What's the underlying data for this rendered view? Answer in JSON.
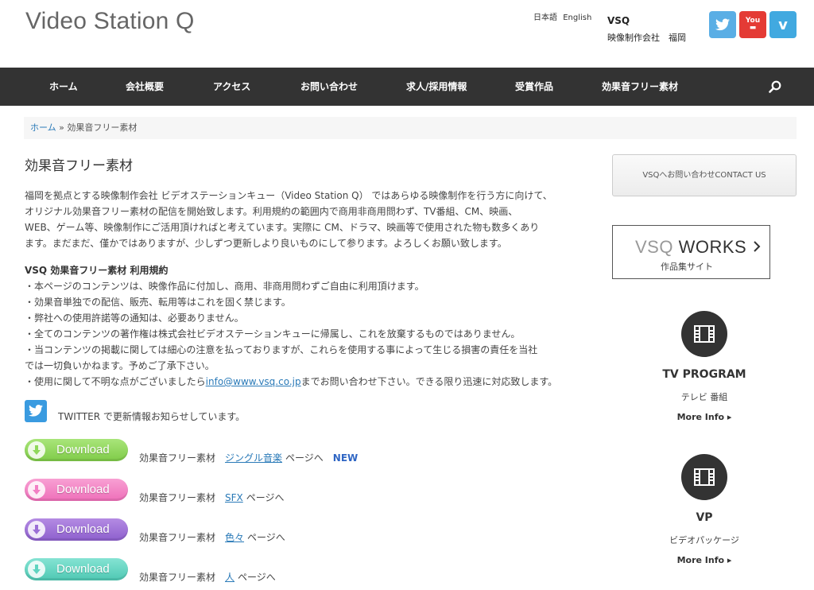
{
  "header": {
    "site_title": "Video Station Q",
    "lang_ja": "日本語",
    "lang_en": "English",
    "company_name": "VSQ",
    "company_desc": "映像制作会社　福岡",
    "social": [
      {
        "name": "twitter",
        "icon": "twitter-icon",
        "color": "#5aaee5"
      },
      {
        "name": "youtube",
        "icon": "youtube-icon",
        "color": "#e43b35",
        "label": "You"
      },
      {
        "name": "vimeo",
        "icon": "vimeo-icon",
        "color": "#41a9e0",
        "label": "v"
      }
    ]
  },
  "nav": {
    "items": [
      {
        "label": "ホーム"
      },
      {
        "label": "会社概要"
      },
      {
        "label": "アクセス"
      },
      {
        "label": "お問い合わせ"
      },
      {
        "label": "求人/採用情報"
      },
      {
        "label": "受賞作品"
      },
      {
        "label": "効果音フリー素材"
      }
    ],
    "search_icon": "search-icon"
  },
  "breadcrumb": {
    "home": "ホーム",
    "sep": " » ",
    "current": "効果音フリー素材"
  },
  "main": {
    "title": "効果音フリー素材",
    "intro_lines": [
      "福岡を拠点とする映像制作会社 ビデオステーションキュー（Video Station Q） ではあらゆる映像制作を行う方に向けて、",
      "オリジナル効果音フリー素材の配信を開始致します。利用規約の範囲内で商用非商用問わず、TV番組、CM、映画、",
      "WEB、ゲーム等、映像制作にご活用頂ければと考えています。実際に CM、ドラマ、映画等で使用された物も数多くあり",
      "ます。まだまだ、僅かではありますが、少しずつ更新しより良いものにして参ります。よろしくお願い致します。"
    ],
    "terms_title": "VSQ 効果音フリー素材 利用規約",
    "terms_lines": [
      "・本ページのコンテンツは、映像作品に付加し、商用、非商用問わずご自由に利用頂けます。",
      "・効果音単独での配信、販売、転用等はこれを固く禁じます。",
      "・弊社への使用許諾等の通知は、必要ありません。",
      "・全てのコンテンツの著作権は株式会社ビデオステーションキューに帰属し、これを放棄するものではありません。",
      "・当コンテンツの掲載に関しては細心の注意を払っておりますが、これらを使用する事によって生じる損害の責任を当社",
      "では一切負いかねます。予めご了承下さい。"
    ],
    "contact_prefix": "・使用に関して不明な点がございましたら",
    "contact_email": "info@www.vsq.co.jp",
    "contact_suffix": "までお問い合わせ下さい。できる限り迅速に対応致します。",
    "twitter_text": "TWITTER で更新情報お知らせしています。",
    "downloads": [
      {
        "button": "Download",
        "prefix": "効果音フリー素材",
        "link": "ジングル音楽",
        "suffix": "ページへ",
        "badge": "NEW",
        "color": "#8fd85a",
        "arrow": "#8fd85a"
      },
      {
        "button": "Download",
        "prefix": "効果音フリー素材",
        "link": "SFX",
        "suffix": "ページへ",
        "badge": "",
        "color": "#f27fc4",
        "arrow": "#f27fc4"
      },
      {
        "button": "Download",
        "prefix": "効果音フリー素材",
        "link": "色々",
        "suffix": "ページへ",
        "badge": "",
        "color": "#9b6fd6",
        "arrow": "#9b6fd6"
      },
      {
        "button": "Download",
        "prefix": "効果音フリー素材",
        "link": "人",
        "suffix": "ページへ",
        "badge": "",
        "color": "#5fd4c0",
        "arrow": "#5fd4c0"
      }
    ]
  },
  "sidebar": {
    "contact_button": "VSQへお問い合わせCONTACT US",
    "works_title_light": "VSQ",
    "works_title_dark": " WORKS",
    "works_sub": "作品集サイト",
    "cards": [
      {
        "title": "TV PROGRAM",
        "sub": "テレビ 番組",
        "more": "More Info ▸",
        "icon": "film-icon"
      },
      {
        "title": "VP",
        "sub": "ビデオパッケージ",
        "more": "More Info ▸",
        "icon": "film-icon"
      }
    ]
  }
}
